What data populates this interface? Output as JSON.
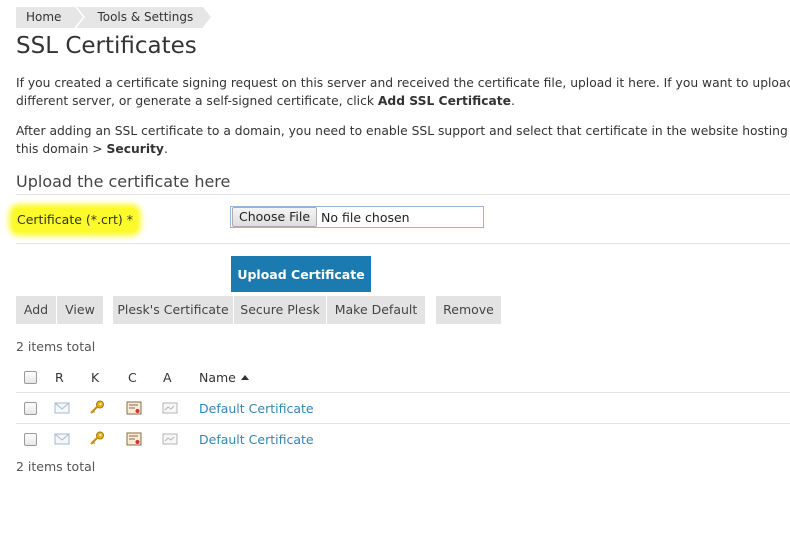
{
  "breadcrumb": {
    "home": "Home",
    "tools": "Tools & Settings"
  },
  "page_title": "SSL Certificates",
  "intro": {
    "line1": "If you created a certificate signing request on this server and received the certificate file, upload it here. If you want to upload a c",
    "line2_pre": "different server, or generate a self-signed certificate, click ",
    "line2_bold": "Add SSL Certificate",
    "line2_post": "."
  },
  "intro2": {
    "line1": "After adding an SSL certificate to a domain, you need to enable SSL support and select that certificate in the website hosting sett",
    "line2_pre": "this domain > ",
    "line2_bold": "Security",
    "line2_post": "."
  },
  "upload_section": {
    "title": "Upload the certificate here",
    "field_label": "Certificate (*.crt) *",
    "choose_file": "Choose File",
    "file_status": "No file chosen",
    "upload_button": "Upload Certificate",
    "highlight_color": "#fcfa2a",
    "button_color": "#1b7bb0"
  },
  "toolbar": {
    "add": "Add",
    "view": "View",
    "plesk_cert": "Plesk's Certificate",
    "secure_plesk": "Secure Plesk",
    "make_default": "Make Default",
    "remove": "Remove"
  },
  "table": {
    "count_top": "2 items total",
    "count_bottom": "2 items total",
    "headers": {
      "r": "R",
      "k": "K",
      "c": "C",
      "a": "A",
      "name": "Name"
    },
    "rows": [
      {
        "name": "Default Certificate",
        "icons": [
          "envelope-icon",
          "key-icon",
          "certificate-icon",
          "ca-icon"
        ]
      },
      {
        "name": "Default Certificate",
        "icons": [
          "envelope-icon",
          "key-icon",
          "certificate-icon",
          "ca-icon"
        ]
      }
    ],
    "link_color": "#2f86b9"
  }
}
